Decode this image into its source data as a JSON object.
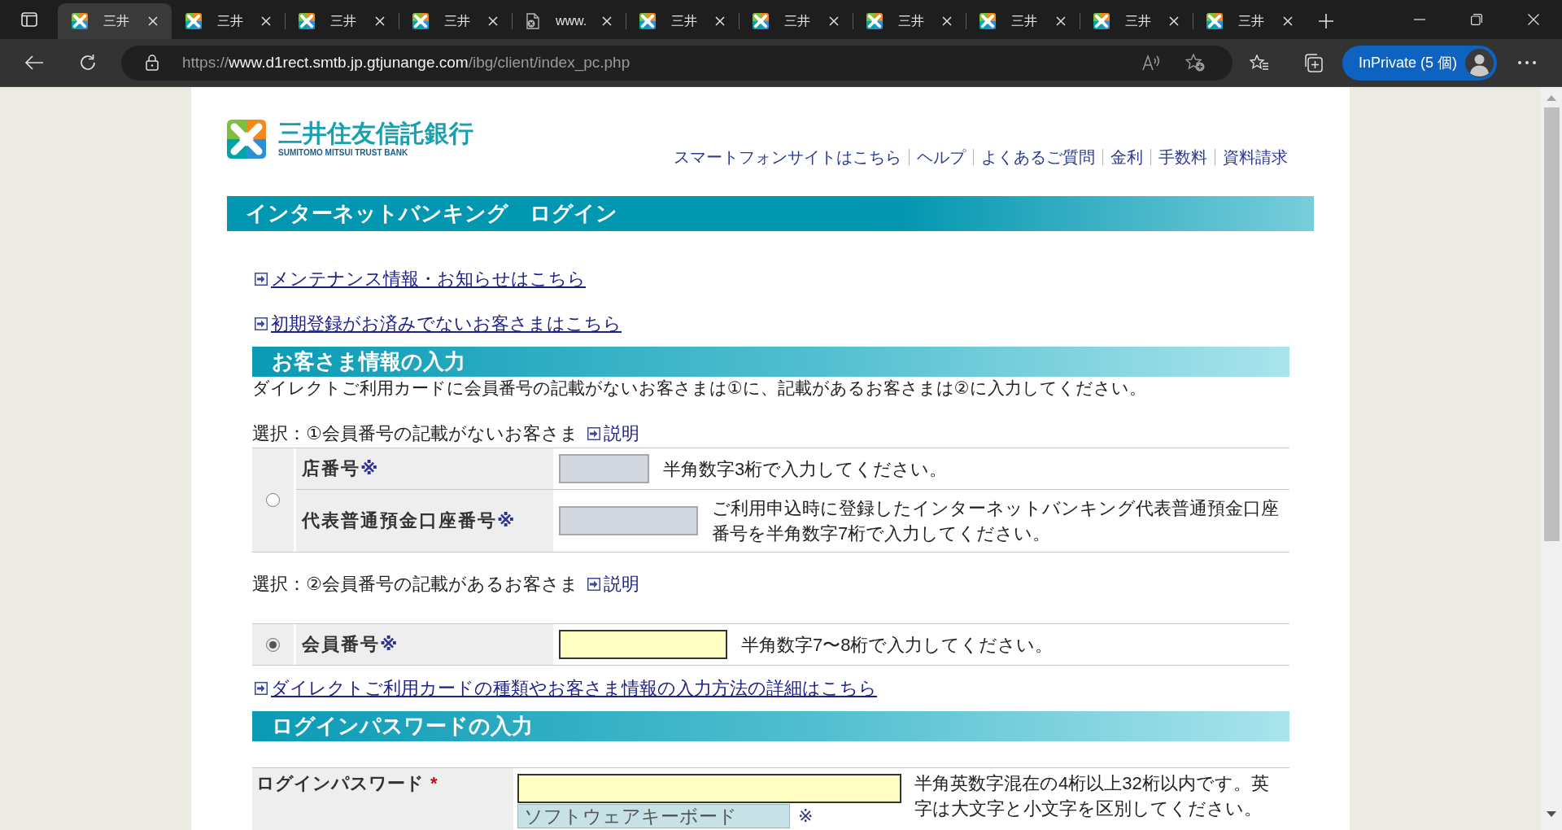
{
  "browser": {
    "tabs": [
      {
        "kind": "site",
        "title": "三井",
        "selected": true
      },
      {
        "kind": "site",
        "title": "三井",
        "selected": false
      },
      {
        "kind": "site",
        "title": "三井",
        "selected": false
      },
      {
        "kind": "site",
        "title": "三井",
        "selected": false
      },
      {
        "kind": "error",
        "title": "www.",
        "selected": false
      },
      {
        "kind": "site",
        "title": "三井",
        "selected": false
      },
      {
        "kind": "site",
        "title": "三井",
        "selected": false
      },
      {
        "kind": "site",
        "title": "三井",
        "selected": false
      },
      {
        "kind": "site",
        "title": "三井",
        "selected": false
      },
      {
        "kind": "site",
        "title": "三井",
        "selected": false
      },
      {
        "kind": "site",
        "title": "三井",
        "selected": false
      }
    ],
    "address": {
      "scheme": "https://",
      "host": "www.d1rect.smtb.jp.gtjunange.com",
      "path": "/ibg/client/index_pc.php"
    },
    "profile": {
      "label": "InPrivate (5 個)"
    }
  },
  "header": {
    "logo": {
      "name": "三井住友信託銀行",
      "subtitle": "SUMITOMO MITSUI TRUST BANK"
    },
    "nav_links": [
      "スマートフォンサイトはこちら",
      "ヘルプ",
      "よくあるご質問",
      "金利",
      "手数料",
      "資料請求"
    ]
  },
  "page_title": "インターネットバンキング　ログイン",
  "notice_links": [
    "メンテナンス情報・お知らせはこちら",
    "初期登録がお済みでないお客さまはこちら"
  ],
  "customer_section": {
    "title": "お客さま情報の入力",
    "description": "ダイレクトご利用カードに会員番号の記載がないお客さまは①に、記載があるお客さまは②に入力してください。",
    "options": [
      {
        "heading": "選択：①会員番号の記載がないお客さま",
        "explain_link": "説明",
        "selected": false,
        "fields": [
          {
            "label": "店番号",
            "required_mark": "※",
            "disabled": true,
            "hint": "半角数字3桁で入力してください。"
          },
          {
            "label": "代表普通預金口座番号",
            "required_mark": "※",
            "disabled": true,
            "hint": "ご利用申込時に登録したインターネットバンキング代表普通預金口座番号を半角数字7桁で入力してください。"
          }
        ]
      },
      {
        "heading": "選択：②会員番号の記載があるお客さま",
        "explain_link": "説明",
        "selected": true,
        "fields": [
          {
            "label": "会員番号",
            "required_mark": "※",
            "disabled": false,
            "hint": "半角数字7〜8桁で入力してください。"
          }
        ]
      }
    ],
    "detail_link": "ダイレクトご利用カードの種類やお客さま情報の入力方法の詳細はこちら"
  },
  "password_section": {
    "title": "ログインパスワードの入力",
    "label": "ログインパスワード",
    "required_mark": "*",
    "hint": "半角英数字混在の4桁以上32桁以内です。英字は大文字と小文字を区別してください。",
    "keyboard_button": "ソフトウェアキーボード",
    "keyboard_mark": "※"
  }
}
